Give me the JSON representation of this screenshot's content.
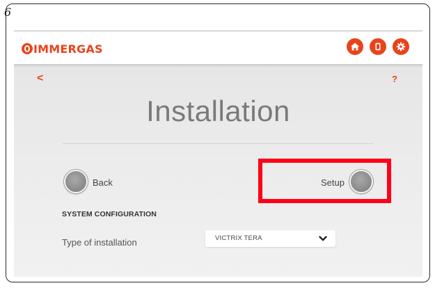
{
  "step_number": "6",
  "header": {
    "logo_text": "IMMERGAS",
    "brand_color": "#e8441b",
    "buttons": [
      {
        "name": "home-button",
        "icon": "home-icon"
      },
      {
        "name": "booklet-button",
        "icon": "booklet-icon"
      },
      {
        "name": "settings-button",
        "icon": "gear-icon"
      }
    ]
  },
  "nav": {
    "back_symbol": "<",
    "help_symbol": "?"
  },
  "page": {
    "title": "Installation"
  },
  "actions": {
    "back_label": "Back",
    "setup_label": "Setup",
    "highlight_color": "#ff0019"
  },
  "config": {
    "section_title": "SYSTEM CONFIGURATION",
    "type_label": "Type of installation",
    "type_value": "VICTRIX TERA"
  }
}
